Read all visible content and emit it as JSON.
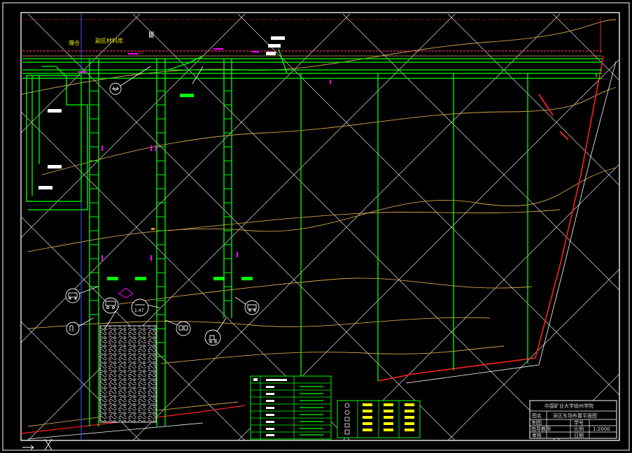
{
  "drawing": {
    "labels": {
      "top_left_1": "爆仓",
      "top_left_2": "副区材料库",
      "roman_mark": "Ⅲ",
      "scale_tag": "1:47"
    },
    "colors": {
      "background": "#000000",
      "frame": "#ffffff",
      "roadway": "#00ff00",
      "contour": "#d2a24a",
      "grid": "#ffffff",
      "boundary": "#ff2020",
      "accent": "#ff00ff",
      "legend_yellow": "#ffff00"
    },
    "symbols": [
      "device-circle-icon",
      "car-symbol-icon",
      "pump-symbol-icon"
    ]
  },
  "title_block": {
    "institution": "中国矿业大学徐州学院",
    "row_label_1": "图名",
    "drawing_title": "采区车场布置平面图",
    "row_label_2": "制图",
    "row_label_3": "指导教师",
    "row_label_4": "审核",
    "col_label_1": "学号",
    "col_label_2": "比例",
    "col_label_3": "日期",
    "scale_value": "1:2000"
  }
}
